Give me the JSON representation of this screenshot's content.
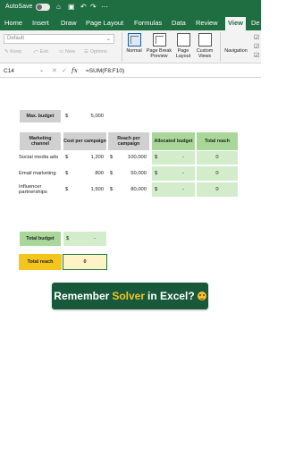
{
  "titlebar": {
    "autosave_label": "AutoSave",
    "icons": [
      "home-icon",
      "save-icon",
      "undo-icon",
      "redo-icon",
      "more-icon"
    ]
  },
  "tabs": [
    "Home",
    "Insert",
    "Draw",
    "Page Layout",
    "Formulas",
    "Data",
    "Review",
    "View",
    "De"
  ],
  "active_tab": "View",
  "ribbon": {
    "sheet_view_select": "Default",
    "sheet_view_buttons": {
      "keep": "Keep",
      "exit": "Exit",
      "new": "New",
      "options": "Options"
    },
    "workbook_views": {
      "normal": "Normal",
      "page_break": "Page Break Preview",
      "page_layout": "Page Layout",
      "custom": "Custom Views"
    },
    "navigation": "Navigation"
  },
  "formula_bar": {
    "name_box": "C14",
    "fx": "fx",
    "formula": "=SUM(F8:F10)"
  },
  "sheet": {
    "max_budget": {
      "label": "Max. budget",
      "currency": "$",
      "value": "5,000"
    },
    "headers": {
      "channel": "Marketing channel",
      "cost": "Cost per campaign",
      "reach": "Reach per campaign",
      "allocated": "Allocated budget",
      "total_reach": "Total reach"
    },
    "rows": [
      {
        "channel": "Social media ads",
        "cost": "1,200",
        "reach": "100,000",
        "allocated": "-",
        "total_reach": "0"
      },
      {
        "channel": "Email marketing",
        "cost": "800",
        "reach": "50,000",
        "allocated": "-",
        "total_reach": "0"
      },
      {
        "channel": "Influencer partnerships",
        "cost": "1,500",
        "reach": "80,000",
        "allocated": "-",
        "total_reach": "0"
      }
    ],
    "currency": "$",
    "total_budget": {
      "label": "Total budget",
      "currency": "$",
      "value": "-"
    },
    "total_reach": {
      "label": "Total reach",
      "value": "0"
    }
  },
  "banner": {
    "before": "Remember",
    "highlight": "Solver",
    "after": "in Excel?"
  },
  "colors": {
    "excel_green": "#1e6e42",
    "header_gray": "#d0d0d0",
    "header_green": "#a9d79a",
    "input_green": "#d3eccb",
    "highlight_yellow": "#f4c51c",
    "banner_bg": "#17593a"
  }
}
